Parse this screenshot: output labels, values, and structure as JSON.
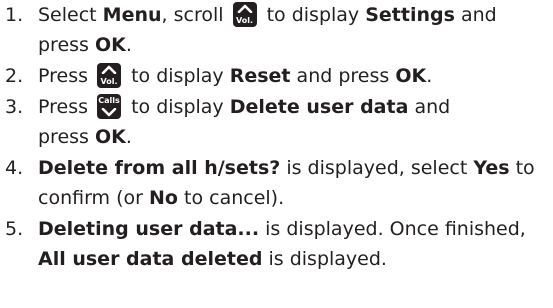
{
  "steps": [
    {
      "number": "1.",
      "line1": {
        "a": "Select ",
        "b1": "Menu",
        "c": ", scroll ",
        "d": " to display ",
        "b2": "Settings",
        "e": " and"
      },
      "line2": {
        "a": "press ",
        "b1": "OK",
        "c": "."
      },
      "key": {
        "icon": "vol-up-key-icon",
        "label": "Vol."
      }
    },
    {
      "number": "2.",
      "line1": {
        "a": "Press ",
        "d": " to display ",
        "b1": "Reset",
        "c": " and press ",
        "b2": "OK",
        "e": "."
      },
      "key": {
        "icon": "vol-up-key-icon",
        "label": "Vol."
      }
    },
    {
      "number": "3.",
      "line1": {
        "a": "Press ",
        "d": " to display ",
        "b1": "Delete user data",
        "c": " and"
      },
      "line2": {
        "a": "press ",
        "b1": "OK",
        "c": "."
      },
      "key": {
        "icon": "calls-down-key-icon",
        "label": "Calls"
      }
    },
    {
      "number": "4.",
      "line1": {
        "b1": "Delete from all h/sets?",
        "a": " is displayed, select ",
        "b2": "Yes",
        "c": " to"
      },
      "line2": {
        "a": "confirm (or ",
        "b1": "No",
        "c": " to cancel)."
      }
    },
    {
      "number": "5.",
      "line1": {
        "b1": "Deleting user data...",
        "a": " is displayed. Once finished,"
      },
      "line2": {
        "b1": "All user data deleted",
        "a": " is displayed."
      }
    }
  ],
  "colors": {
    "text": "#231f20",
    "key_background": "#231f20",
    "key_foreground": "#ffffff"
  }
}
